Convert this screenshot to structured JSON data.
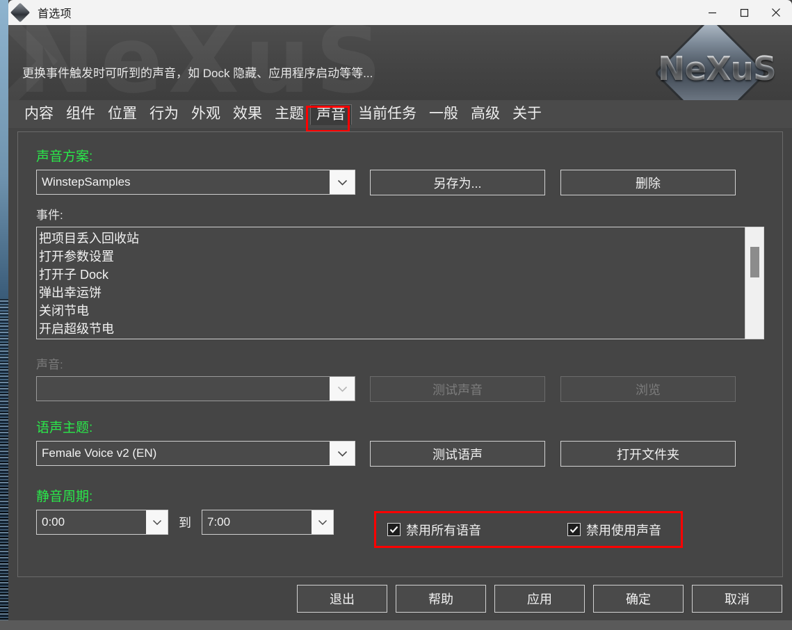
{
  "window": {
    "title": "首选项",
    "icon": "diamond-icon",
    "controls": {
      "minimize": "minimize-icon",
      "maximize": "maximize-icon",
      "close": "close-icon"
    }
  },
  "banner": {
    "description": "更换事件触发时可听到的声音，如 Dock 隐藏、应用程序启动等等...",
    "watermark": "NeXuS",
    "logo_text": "NeXuS"
  },
  "tabs": [
    {
      "label": "内容",
      "selected": false
    },
    {
      "label": "组件",
      "selected": false
    },
    {
      "label": "位置",
      "selected": false
    },
    {
      "label": "行为",
      "selected": false
    },
    {
      "label": "外观",
      "selected": false
    },
    {
      "label": "效果",
      "selected": false
    },
    {
      "label": "主题",
      "selected": false
    },
    {
      "label": "声音",
      "selected": true
    },
    {
      "label": "当前任务",
      "selected": false
    },
    {
      "label": "一般",
      "selected": false
    },
    {
      "label": "高级",
      "selected": false
    },
    {
      "label": "关于",
      "selected": false
    }
  ],
  "sound_scheme": {
    "label": "声音方案:",
    "value": "WinstepSamples",
    "save_as_label": "另存为...",
    "delete_label": "删除"
  },
  "events": {
    "label": "事件:",
    "items": [
      "把项目丢入回收站",
      "打开参数设置",
      "打开子 Dock",
      "弹出幸运饼",
      "关闭节电",
      "开启超级节电"
    ]
  },
  "sound": {
    "label": "声音:",
    "value": "",
    "test_label": "测试声音",
    "browse_label": "浏览",
    "disabled": true
  },
  "voice_theme": {
    "label": "语声主题:",
    "value": "Female Voice v2 (EN)",
    "test_label": "测试语声",
    "open_folder_label": "打开文件夹"
  },
  "silent_period": {
    "label": "静音周期:",
    "from_value": "0:00",
    "to_word": "到",
    "to_value": "7:00",
    "checkboxes": [
      {
        "label": "禁用所有语音",
        "checked": true
      },
      {
        "label": "禁用使用声音",
        "checked": true
      }
    ]
  },
  "footer": {
    "buttons": [
      "退出",
      "帮助",
      "应用",
      "确定",
      "取消"
    ]
  },
  "colors": {
    "window_bg": "#444444",
    "group_label": "#2ae84a",
    "annotation": "#ff0000",
    "titlebar_bg": "#f3f3f3"
  }
}
